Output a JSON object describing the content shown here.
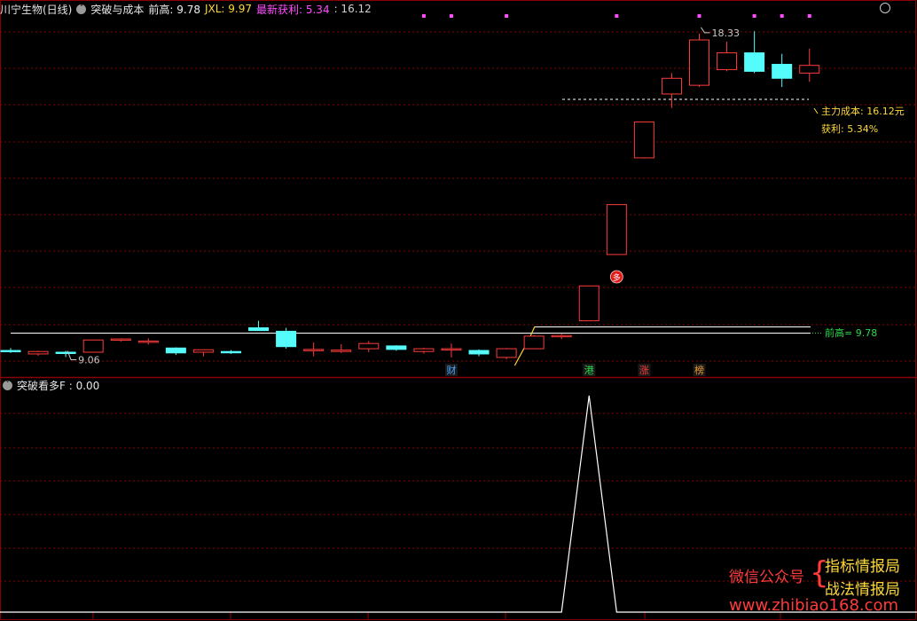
{
  "main_header": {
    "stock_name": "川宁生物(日线)",
    "indicator_name": "突破与成本",
    "prev_high_label": "前高: 9.78",
    "jxl_label": "JXL: 9.97",
    "profit_label": "最新获利: 5.34",
    "cost_value": ": 16.12",
    "collapse_icon": "chevron-down-icon",
    "settings_icon": "circle-icon"
  },
  "sub_header": {
    "indicator_label": "突破看多F : 0.00",
    "collapse_icon": "chevron-down-icon"
  },
  "annotations": {
    "high_label": "18.33",
    "low_label": "9.06",
    "cost_label": "主力成本: 16.12元",
    "profit_label": "获利: 5.34%",
    "prev_high_line_label": "前高= 9.78",
    "buy_signal": "多"
  },
  "event_markers": [
    {
      "label": "财",
      "color": "#4aa8ff"
    },
    {
      "label": "港",
      "color": "#2ad94a"
    },
    {
      "label": "涨",
      "color": "#ff3a3a"
    },
    {
      "label": "榜",
      "color": "#e89a2a"
    }
  ],
  "watermark": {
    "left_text": "微信公众号",
    "line1": "指标情报局",
    "line2": "战法情报局",
    "url": "www.zhibiao168.com"
  },
  "colors": {
    "up": "#ff3b3b",
    "down": "#54fcfc",
    "grid": "#8a0000",
    "yellow": "#ffd83a",
    "magenta": "#ff4cff",
    "green_label": "#2ad94a",
    "white": "#ffffff"
  },
  "chart_data": [
    {
      "type": "candlestick",
      "title": "突破与成本",
      "ylim": [
        8.6,
        19.0
      ],
      "candles": [
        {
          "o": 9.25,
          "h": 9.32,
          "l": 9.18,
          "c": 9.22
        },
        {
          "o": 9.15,
          "h": 9.24,
          "l": 9.1,
          "c": 9.22
        },
        {
          "o": 9.2,
          "h": 9.24,
          "l": 9.06,
          "c": 9.17
        },
        {
          "o": 9.2,
          "h": 9.55,
          "l": 9.2,
          "c": 9.55
        },
        {
          "o": 9.55,
          "h": 9.6,
          "l": 9.5,
          "c": 9.58
        },
        {
          "o": 9.52,
          "h": 9.6,
          "l": 9.42,
          "c": 9.52
        },
        {
          "o": 9.32,
          "h": 9.34,
          "l": 9.12,
          "c": 9.18
        },
        {
          "o": 9.2,
          "h": 9.28,
          "l": 9.08,
          "c": 9.27
        },
        {
          "o": 9.22,
          "h": 9.26,
          "l": 9.15,
          "c": 9.2
        },
        {
          "o": 9.9,
          "h": 10.1,
          "l": 9.82,
          "c": 9.82
        },
        {
          "o": 9.8,
          "h": 9.9,
          "l": 9.3,
          "c": 9.36
        },
        {
          "o": 9.28,
          "h": 9.48,
          "l": 9.08,
          "c": 9.28
        },
        {
          "o": 9.22,
          "h": 9.43,
          "l": 9.18,
          "c": 9.26
        },
        {
          "o": 9.3,
          "h": 9.52,
          "l": 9.2,
          "c": 9.45
        },
        {
          "o": 9.38,
          "h": 9.4,
          "l": 9.24,
          "c": 9.28
        },
        {
          "o": 9.22,
          "h": 9.33,
          "l": 9.16,
          "c": 9.3
        },
        {
          "o": 9.28,
          "h": 9.45,
          "l": 9.05,
          "c": 9.3
        },
        {
          "o": 9.25,
          "h": 9.28,
          "l": 9.08,
          "c": 9.15
        },
        {
          "o": 9.05,
          "h": 9.32,
          "l": 9.0,
          "c": 9.3
        },
        {
          "o": 9.3,
          "h": 9.7,
          "l": 9.3,
          "c": 9.66
        },
        {
          "o": 9.68,
          "h": 9.72,
          "l": 9.58,
          "c": 9.68
        },
        {
          "o": 10.1,
          "h": 11.1,
          "l": 10.1,
          "c": 11.1
        },
        {
          "o": 12.0,
          "h": 13.43,
          "l": 11.99,
          "c": 13.43
        },
        {
          "o": 14.77,
          "h": 15.8,
          "l": 14.75,
          "c": 15.8
        },
        {
          "o": 16.6,
          "h": 17.2,
          "l": 16.2,
          "c": 17.05
        },
        {
          "o": 16.85,
          "h": 18.33,
          "l": 16.8,
          "c": 18.15
        },
        {
          "o": 17.3,
          "h": 18.1,
          "l": 17.25,
          "c": 17.78
        },
        {
          "o": 17.78,
          "h": 18.4,
          "l": 17.2,
          "c": 17.25
        },
        {
          "o": 17.45,
          "h": 17.75,
          "l": 16.8,
          "c": 17.05
        },
        {
          "o": 17.2,
          "h": 17.9,
          "l": 16.95,
          "c": 17.42
        }
      ],
      "prev_high": 9.78,
      "cost": 16.12,
      "breakout_index": 19,
      "magenta_dots": [
        15,
        16,
        18,
        22,
        25,
        27,
        28,
        29
      ]
    },
    {
      "type": "line",
      "title": "突破看多F",
      "ylim": [
        0,
        1
      ],
      "values": [
        0,
        0,
        0,
        0,
        0,
        0,
        0,
        0,
        0,
        0,
        0,
        0,
        0,
        0,
        0,
        0,
        0,
        0,
        0,
        0,
        0,
        1,
        0,
        0,
        0,
        0,
        0,
        0,
        0,
        0
      ]
    }
  ]
}
